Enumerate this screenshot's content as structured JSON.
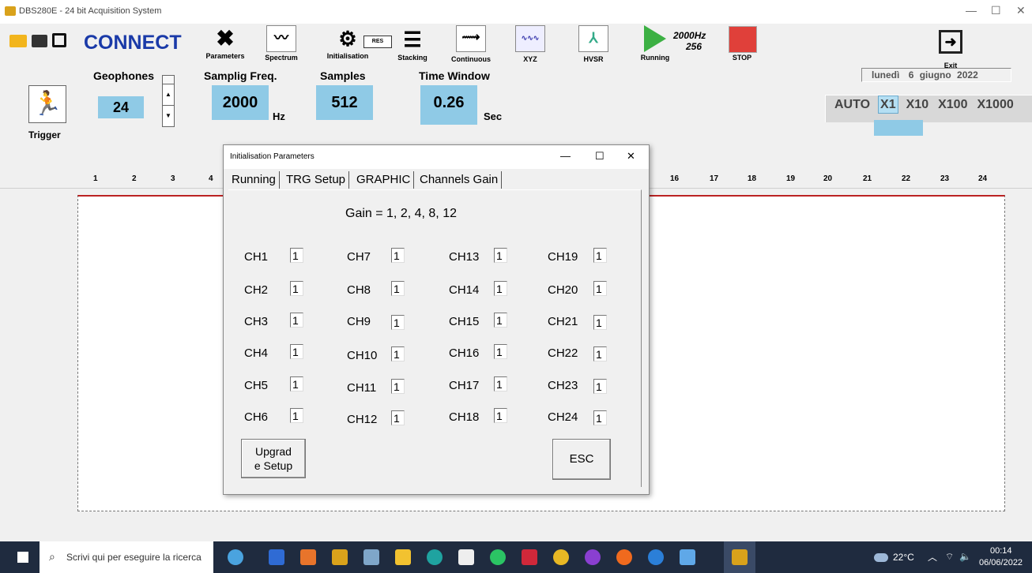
{
  "window": {
    "title": "DBS280E - 24 bit Acquisition System"
  },
  "toolbar": {
    "connect_label": "CONNECT",
    "parameters_label": "Parameters",
    "spectrum_label": "Spectrum",
    "initialisation_label": "Initialisation",
    "res_label": "RES",
    "stacking_label": "Stacking",
    "continuous_label": "Continuous",
    "xyz_label": "XYZ",
    "hvsr_label": "HVSR",
    "running_label": "Running",
    "freq_line1": "2000Hz",
    "freq_line2": "256",
    "stop_label": "STOP",
    "exit_label": "Exit"
  },
  "settings": {
    "geophones_label": "Geophones",
    "geophones_value": "24",
    "sampling_label": "Samplig Freq.",
    "sampling_value": "2000",
    "sampling_unit": "Hz",
    "samples_label": "Samples",
    "samples_value": "512",
    "timewindow_label": "Time Window",
    "timewindow_value": "0.26",
    "timewindow_unit": "Sec",
    "trigger_label": "Trigger"
  },
  "date": {
    "day_name": "lunedì",
    "day": "6",
    "month": "giugno",
    "year": "2022"
  },
  "zoom": {
    "options": [
      "AUTO",
      "X1",
      "X10",
      "X100",
      "X1000"
    ],
    "selected": "X1"
  },
  "channel_ruler": [
    "1",
    "2",
    "3",
    "4",
    "16",
    "17",
    "18",
    "19",
    "20",
    "21",
    "22",
    "23",
    "24"
  ],
  "dialog": {
    "title": "Initialisation Parameters",
    "tabs": [
      "Running",
      "TRG Setup",
      "GRAPHIC",
      "Channels Gain"
    ],
    "active_tab": "Channels Gain",
    "gain_text": "Gain = 1, 2, 4, 8, 12",
    "channels": [
      [
        "CH1",
        "1"
      ],
      [
        "CH2",
        "1"
      ],
      [
        "CH3",
        "1"
      ],
      [
        "CH4",
        "1"
      ],
      [
        "CH5",
        "1"
      ],
      [
        "CH6",
        "1"
      ],
      [
        "CH7",
        "1"
      ],
      [
        "CH8",
        "1"
      ],
      [
        "CH9",
        "1"
      ],
      [
        "CH10",
        "1"
      ],
      [
        "CH11",
        "1"
      ],
      [
        "CH12",
        "1"
      ],
      [
        "CH13",
        "1"
      ],
      [
        "CH14",
        "1"
      ],
      [
        "CH15",
        "1"
      ],
      [
        "CH16",
        "1"
      ],
      [
        "CH17",
        "1"
      ],
      [
        "CH18",
        "1"
      ],
      [
        "CH19",
        "1"
      ],
      [
        "CH20",
        "1"
      ],
      [
        "CH21",
        "1"
      ],
      [
        "CH22",
        "1"
      ],
      [
        "CH23",
        "1"
      ],
      [
        "CH24",
        "1"
      ]
    ],
    "upgrade_line1": "Upgrad",
    "upgrade_line2": "e Setup",
    "esc_label": "ESC"
  },
  "taskbar": {
    "search_placeholder": "Scrivi qui per eseguire la ricerca",
    "temperature": "22°C",
    "time": "00:14",
    "date": "06/06/2022"
  }
}
